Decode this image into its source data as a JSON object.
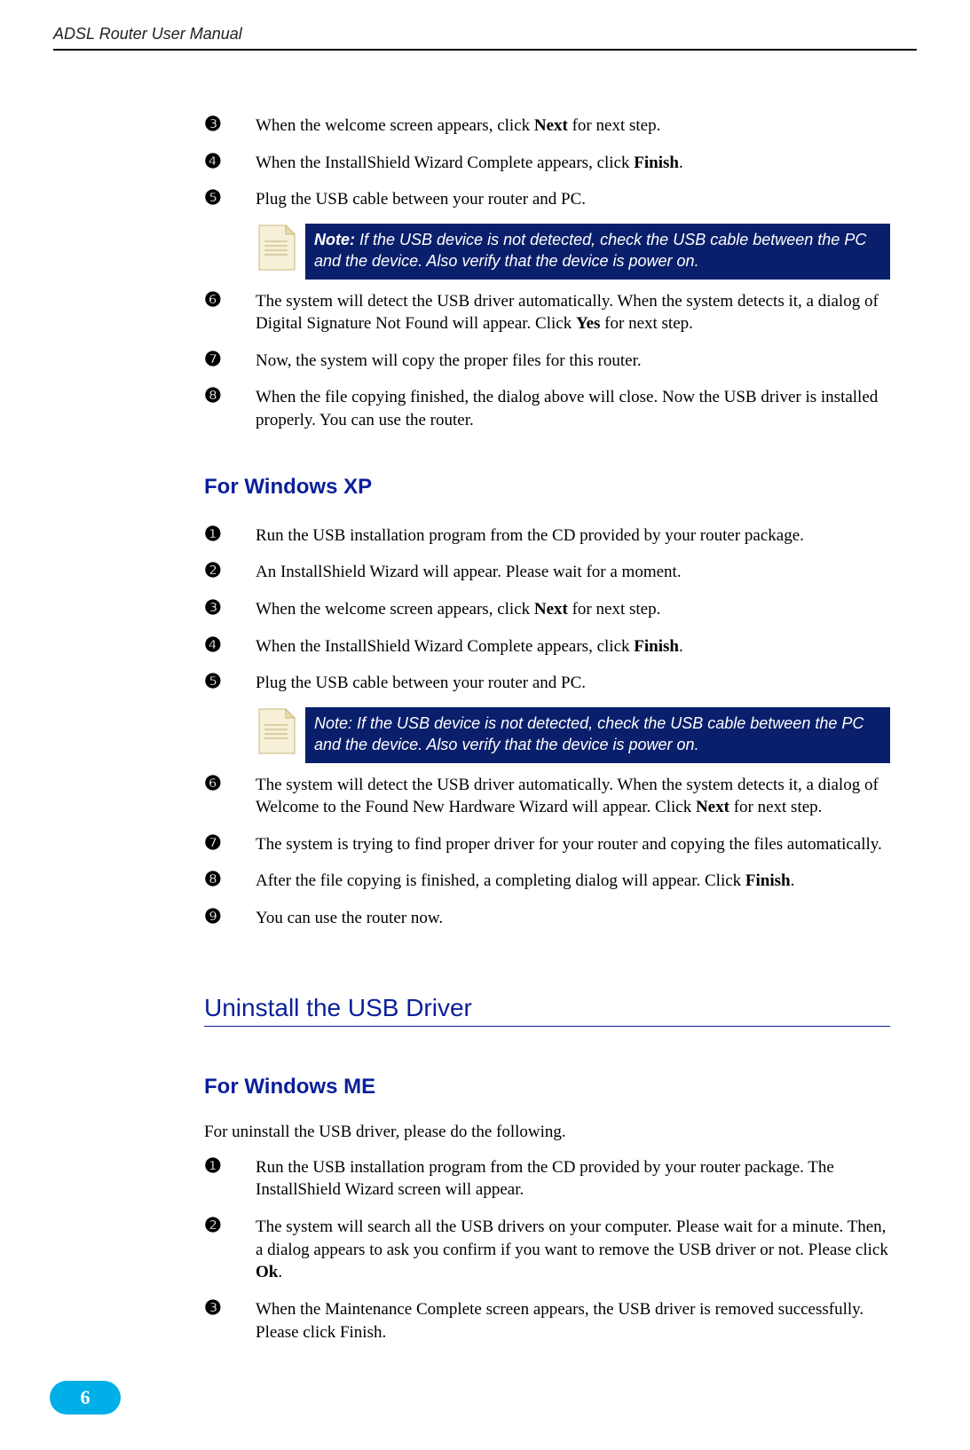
{
  "header": {
    "title": "ADSL Router User Manual"
  },
  "section1": {
    "steps": [
      {
        "num": "❸",
        "html": "When the welcome screen appears, click <b>Next</b> for next step."
      },
      {
        "num": "❹",
        "html": "When the InstallShield Wizard Complete appears, click <b>Finish</b>."
      },
      {
        "num": "❺",
        "html": "Plug the USB cable between your router and PC."
      }
    ],
    "note": {
      "label": "Note:",
      "text": " If the USB device is not detected, check the USB cable between the PC and the device. Also verify that the device is power on."
    },
    "steps_after": [
      {
        "num": "❻",
        "html": "The system will detect the USB driver automatically. When the system detects it, a dialog of Digital Signature Not Found will appear. Click <b>Yes</b> for next step."
      },
      {
        "num": "❼",
        "html": "Now, the system will copy the proper files for this router."
      },
      {
        "num": "❽",
        "html": "When the file copying finished, the dialog above will close. Now the USB driver is installed properly. You can use the router."
      }
    ]
  },
  "section2": {
    "heading": "For Windows XP",
    "steps": [
      {
        "num": "❶",
        "html": "Run the USB installation program from the CD provided by your router package."
      },
      {
        "num": "❷",
        "html": "An InstallShield Wizard will appear. Please wait for a moment."
      },
      {
        "num": "❸",
        "html": "When the welcome screen appears, click <b>Next</b> for next step."
      },
      {
        "num": "❹",
        "html": "When the InstallShield Wizard Complete appears, click <b>Finish</b>."
      },
      {
        "num": "❺",
        "html": "Plug the USB cable between your router and PC."
      }
    ],
    "note": {
      "label": "Note:",
      "text": " If the USB device is not detected, check the USB cable between the PC and the device. Also verify that the device is power on."
    },
    "steps_after": [
      {
        "num": "❻",
        "html": "The system will detect the USB driver automatically. When the system detects it, a dialog of Welcome to the Found New Hardware Wizard will appear. Click <b>Next</b> for next step."
      },
      {
        "num": "❼",
        "html": "The system is trying to find proper driver for your router and copying the files automatically."
      },
      {
        "num": "❽",
        "html": "After the file copying is finished, a completing dialog will appear. Click <b>Finish</b>."
      },
      {
        "num": "❾",
        "html": "You can use the router now."
      }
    ]
  },
  "section3": {
    "heading_h1": "Uninstall the USB Driver",
    "heading_h2": "For Windows ME",
    "intro": "For uninstall the USB driver, please do the following.",
    "steps": [
      {
        "num": "❶",
        "html": "Run the USB installation program from the CD provided by your router package. The InstallShield Wizard screen will appear."
      },
      {
        "num": "❷",
        "html": "The system will search all the USB drivers on your computer. Please wait for a minute. Then, a dialog appears to ask you confirm if you want to remove the USB driver or not. Please click <b>Ok</b>."
      },
      {
        "num": "❸",
        "html": "When the Maintenance Complete screen appears, the USB driver is removed successfully. Please click Finish."
      }
    ]
  },
  "page_number": "6",
  "icons": {
    "note_icon_name": "note-paper-icon"
  }
}
